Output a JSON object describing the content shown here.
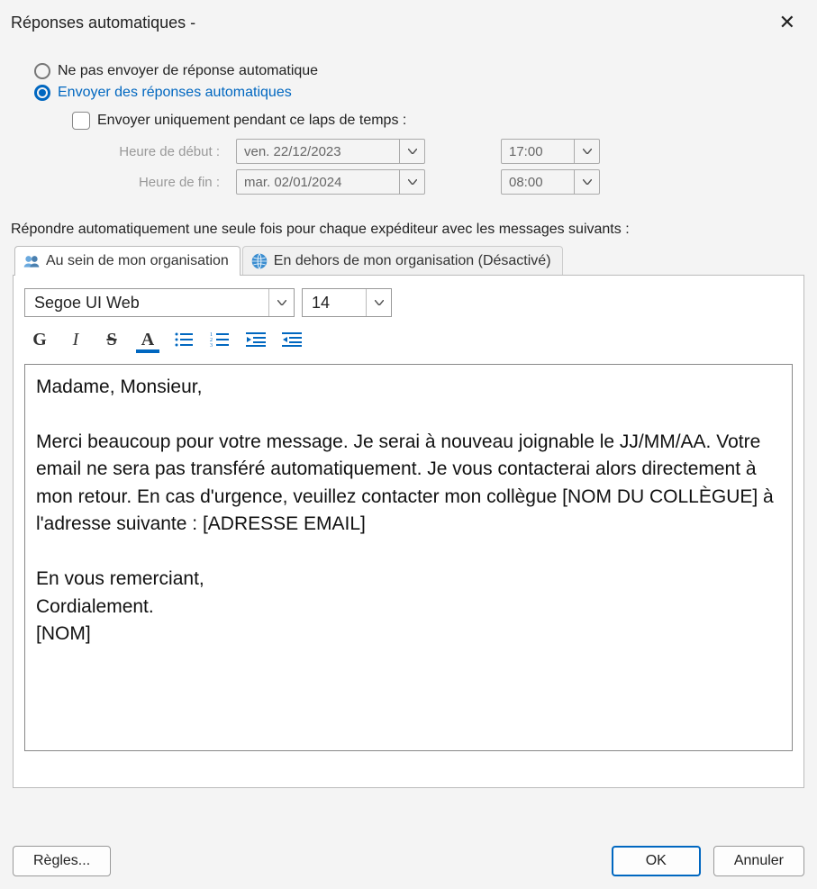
{
  "window": {
    "title": "Réponses automatiques -"
  },
  "options": {
    "no_send": "Ne pas envoyer de réponse automatique",
    "send": "Envoyer des réponses automatiques",
    "only_during": "Envoyer uniquement pendant ce laps de temps :",
    "start_label": "Heure de début :",
    "end_label": "Heure de fin :",
    "start_date": "ven. 22/12/2023",
    "start_time": "17:00",
    "end_date": "mar. 02/01/2024",
    "end_time": "08:00"
  },
  "instruction": "Répondre automatiquement une seule fois pour chaque expéditeur avec les messages suivants :",
  "tabs": {
    "inside": "Au sein de mon organisation",
    "outside": "En dehors de mon organisation (Désactivé)"
  },
  "format": {
    "font": "Segoe UI Web",
    "size": "14"
  },
  "message": "Madame, Monsieur,\n\nMerci beaucoup pour votre message. Je serai à nouveau joignable le JJ/MM/AA. Votre email ne sera pas transféré automatiquement. Je vous contacterai alors directement à mon retour. En cas d'urgence, veuillez contacter mon collègue [NOM DU COLLÈGUE] à l'adresse suivante : [ADRESSE EMAIL]\n\nEn vous remerciant,\nCordialement.\n[NOM]",
  "buttons": {
    "rules": "Règles...",
    "ok": "OK",
    "cancel": "Annuler"
  }
}
